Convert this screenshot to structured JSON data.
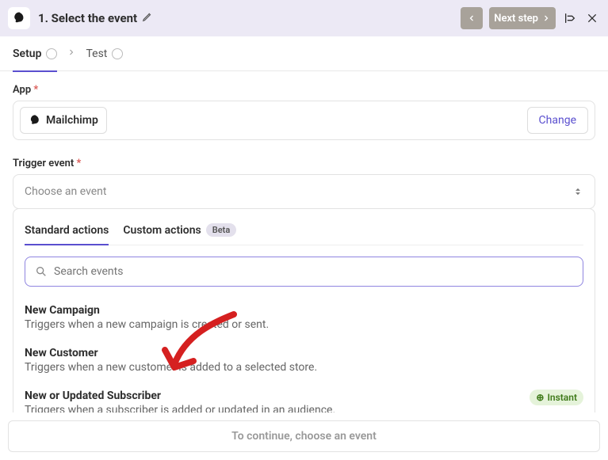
{
  "header": {
    "step_title": "1. Select the event",
    "next_label": "Next step"
  },
  "tabs": {
    "setup": "Setup",
    "test": "Test"
  },
  "app_section": {
    "label": "App",
    "selected": "Mailchimp",
    "change": "Change"
  },
  "trigger_section": {
    "label": "Trigger event",
    "placeholder": "Choose an event"
  },
  "panel": {
    "tab_standard": "Standard actions",
    "tab_custom": "Custom actions",
    "tab_custom_badge": "Beta",
    "search_placeholder": "Search events"
  },
  "events": [
    {
      "title": "New Campaign",
      "desc": "Triggers when a new campaign is created or sent.",
      "instant": false
    },
    {
      "title": "New Customer",
      "desc": "Triggers when a new customer is added to a selected store.",
      "instant": false
    },
    {
      "title": "New or Updated Subscriber",
      "desc": "Triggers when a subscriber is added or updated in an audience.",
      "instant": true
    }
  ],
  "instant_label": "Instant",
  "footer": {
    "button": "To continue, choose an event"
  }
}
